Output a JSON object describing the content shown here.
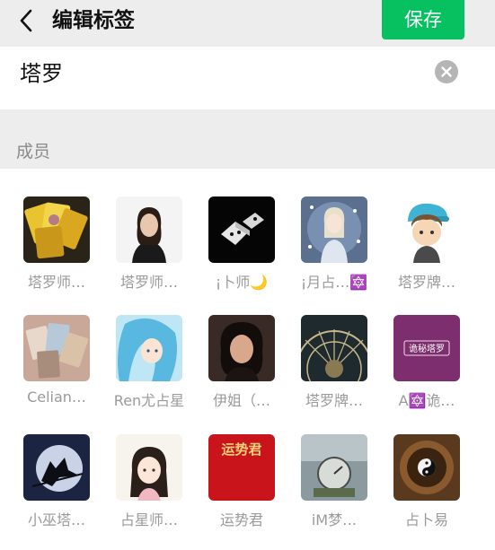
{
  "header": {
    "title": "编辑标签",
    "save_label": "保存"
  },
  "tag": {
    "name": "塔罗"
  },
  "members_section": {
    "label": "成员"
  },
  "members": [
    {
      "name": "塔罗师…",
      "avatar": "tarot-cards-gold"
    },
    {
      "name": "塔罗师…",
      "avatar": "woman-portrait"
    },
    {
      "name": "¡卜师🌙",
      "avatar": "dice-black"
    },
    {
      "name": "¡月占…🔯",
      "avatar": "anime-girl-stars"
    },
    {
      "name": "塔罗牌…",
      "avatar": "cartoon-boy-cap"
    },
    {
      "name": "Celian…",
      "avatar": "tarot-cards-pink"
    },
    {
      "name": "Ren尤占星",
      "avatar": "anime-blue-hair"
    },
    {
      "name": "伊姐（…",
      "avatar": "woman-dark-portrait"
    },
    {
      "name": "塔罗牌…",
      "avatar": "tarot-wheel"
    },
    {
      "name": "A🔯诡…",
      "avatar": "purple-logo"
    },
    {
      "name": "小巫塔…",
      "avatar": "witch-moon"
    },
    {
      "name": "占星师…",
      "avatar": "cartoon-girl"
    },
    {
      "name": "运势君",
      "avatar": "red-calligraphy"
    },
    {
      "name": "iM梦…",
      "avatar": "scale-photo"
    },
    {
      "name": "占卜易",
      "avatar": "bagua-wood"
    }
  ],
  "logo_text": {
    "purple_logo": "诡秘塔罗",
    "red_calligraphy": "运势君"
  },
  "colors": {
    "accent": "#07c160",
    "background": "#ededed"
  }
}
